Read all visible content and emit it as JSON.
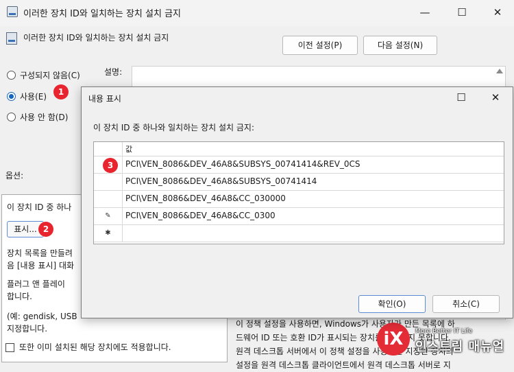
{
  "window": {
    "title": "이러한 장치 ID와 일치하는 장치 설치 금지",
    "policy_title": "이러한 장치 ID와 일치하는 장치 설치 금지",
    "prev_label": "이전 설정(P)",
    "next_label": "다음 설정(N)"
  },
  "state": {
    "options": [
      {
        "label": "구성되지 않음(C)",
        "checked": false
      },
      {
        "label": "사용(E)",
        "checked": true
      },
      {
        "label": "사용 안 함(D)",
        "checked": false
      }
    ],
    "description_label": "설명:"
  },
  "options_panel": {
    "label": "옵션:",
    "line1": "이 장치 ID 중 하나",
    "show_button": "표시...",
    "line2": "장치 목록을 만들려",
    "line3": "음 [내용 표시] 대화",
    "line4": "플러그 앤 플레이",
    "line5": "합니다.",
    "line6": "(예: gendisk,  USB",
    "line7": "지정합니다.",
    "checkbox_label": "또한 이미 설치된 해당 장치에도 적용합니다."
  },
  "help": {
    "line1": "이 정책 설정을 사용하면, Windows가 사용자가 만든 목록에 하",
    "line2": "드웨어 ID 또는 호환 ID가 표시되는 장치를 설치하지 못합니다.",
    "line3": "원격 데스크톱 서버에서 이 정책 설정을 사용하면 지정된 장치의",
    "line4": "설정을 원격 데스크톱 클라이언트에서 원격 데스크톱 서버로 지"
  },
  "dialog": {
    "title": "내용 표시",
    "prompt": "이 장치 ID 중 하나와 일치하는 장치 설치 금지:",
    "column_header": "값",
    "rows": [
      "PCI\\VEN_8086&DEV_46A8&SUBSYS_00741414&REV_0CS",
      "PCI\\VEN_8086&DEV_46A8&SUBSYS_00741414",
      "PCI\\VEN_8086&DEV_46A8&CC_030000",
      "PCI\\VEN_8086&DEV_46A8&CC_0300",
      ""
    ],
    "ok_label": "확인(O)",
    "cancel_label": "취소(C)"
  },
  "badges": {
    "b1": "1",
    "b2": "2",
    "b3": "3"
  },
  "watermark": {
    "mark": "iX",
    "tagline": "More Better IT Life",
    "name": "인스트림 매뉴얼"
  },
  "colors": {
    "accent": "#1565c0",
    "badge": "#e8242f"
  }
}
